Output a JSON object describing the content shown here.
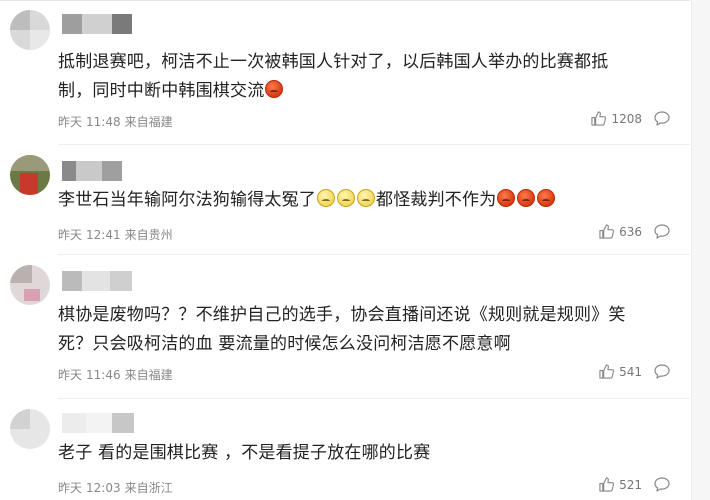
{
  "comments": [
    {
      "lines": [
        [
          {
            "t": "抵制退赛吧，柯洁不止一次被韩国人针对了，以后韩国人举办的比赛都抵"
          }
        ],
        [
          {
            "t": "制，同时中断中韩围棋交流"
          },
          {
            "emoji": "angry"
          }
        ]
      ],
      "date": "昨天",
      "time": "11:48",
      "location": "来自福建",
      "likes": "1208"
    },
    {
      "lines": [
        [
          {
            "t": "李世石当年输阿尔法狗输得太冤了"
          },
          {
            "emoji": "sad"
          },
          {
            "emoji": "sad"
          },
          {
            "emoji": "sad"
          },
          {
            "t": "都怪裁判不作为"
          },
          {
            "emoji": "angry"
          },
          {
            "emoji": "angry"
          },
          {
            "emoji": "angry"
          }
        ]
      ],
      "date": "昨天",
      "time": "12:41",
      "location": "来自贵州",
      "likes": "636"
    },
    {
      "lines": [
        [
          {
            "t": "棋协是废物吗？？不维护自己的选手，协会直播间还说《规则就是规则》笑"
          }
        ],
        [
          {
            "t": "死？只会吸柯洁的血 要流量的时候怎么没问柯洁愿不愿意啊"
          }
        ]
      ],
      "date": "昨天",
      "time": "11:46",
      "location": "来自福建",
      "likes": "541"
    },
    {
      "lines": [
        [
          {
            "t": "老子 看的是围棋比赛 ，不是看提子放在哪的比赛"
          }
        ]
      ],
      "date": "昨天",
      "time": "12:03",
      "location": "来自浙江",
      "likes": "521"
    }
  ],
  "colors": {
    "text": "#222222",
    "meta": "#888888",
    "angry_emoji": "#d83a14",
    "sad_emoji": "#f2d454"
  },
  "icons": {
    "like": "thumbs-up-icon",
    "reply": "comment-bubble-icon"
  }
}
